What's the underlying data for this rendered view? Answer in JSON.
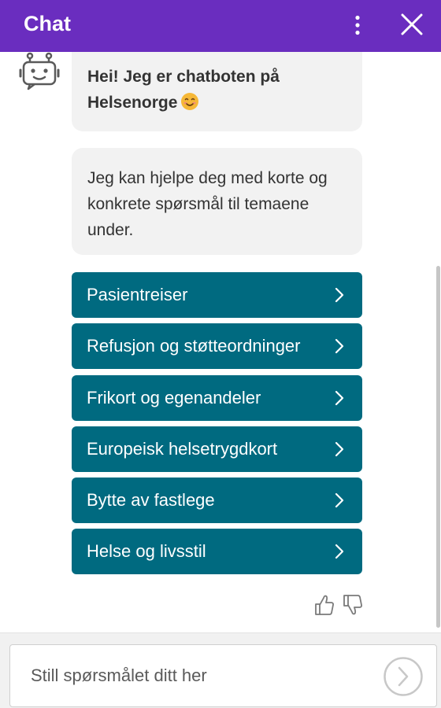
{
  "header": {
    "title": "Chat"
  },
  "messages": [
    {
      "line1": "Hei! Jeg er chatboten på",
      "line2": "Helsenorge",
      "emoji": "smiling-face-emoji"
    },
    {
      "text": "Jeg kan hjelpe deg med korte og konkrete spørsmål til temaene under."
    }
  ],
  "topics": [
    {
      "label": "Pasientreiser"
    },
    {
      "label": "Refusjon og støtteordninger"
    },
    {
      "label": "Frikort og egenandeler"
    },
    {
      "label": "Europeisk helsetrygdkort"
    },
    {
      "label": "Bytte av fastlege"
    },
    {
      "label": "Helse og livsstil"
    }
  ],
  "input": {
    "placeholder": "Still spørsmålet ditt her"
  },
  "icons": {
    "menu": "more-vertical-icon",
    "close": "close-icon",
    "avatar": "robot-icon",
    "chevron": "chevron-right-icon",
    "thumbs_up": "thumbs-up-icon",
    "thumbs_down": "thumbs-down-icon",
    "send": "send-icon"
  },
  "colors": {
    "header": "#6a2dbf",
    "topic_button": "#006a80",
    "bubble": "#f2f2f2"
  }
}
